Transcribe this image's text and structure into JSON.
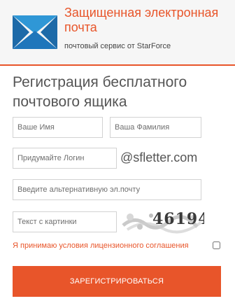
{
  "header": {
    "brand_title": "Защищенная электронная почта",
    "brand_subtitle": "почтовый сервис от StarForce",
    "colors": {
      "accent": "#e8552a",
      "logo_dark": "#1d6aa8",
      "logo_light": "#2f97d6"
    }
  },
  "form": {
    "title": "Регистрация бесплатного почтового ящика",
    "first_name_placeholder": "Ваше Имя",
    "last_name_placeholder": "Ваша Фамилия",
    "login_placeholder": "Придумайте Логин",
    "domain": "@sfletter.com",
    "alt_email_placeholder": "Введите альтернативную эл.почту",
    "captcha_placeholder": "Текст с картинки",
    "captcha_text": "46194",
    "terms_label": "Я принимаю условия лицензионного соглашения",
    "submit_label": "ЗАРЕГИСТРИРОВАТЬСЯ"
  }
}
